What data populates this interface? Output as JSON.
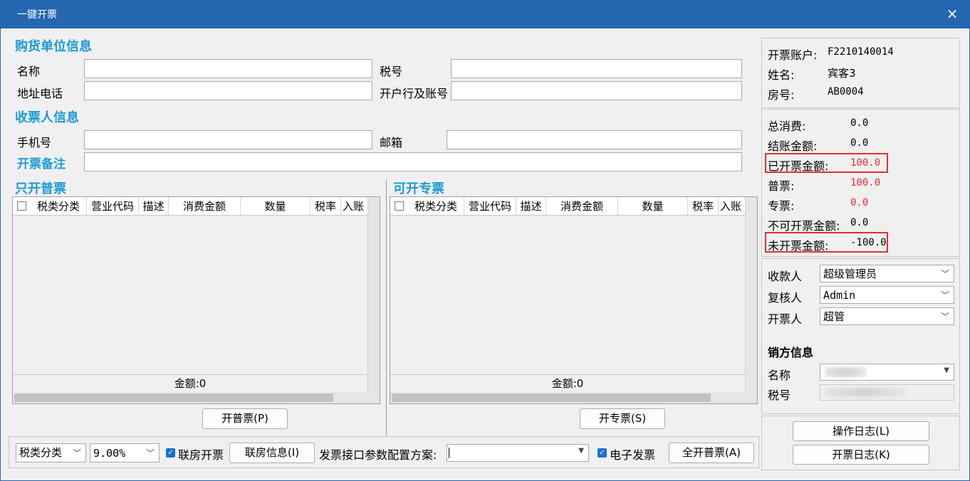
{
  "window": {
    "title": "一键开票",
    "close_glyph": "×"
  },
  "buyer": {
    "section_title": "购货单位信息",
    "name_label": "名称",
    "name_value": "",
    "tax_label": "税号",
    "tax_value": "",
    "address_label": "地址电话",
    "address_value": "",
    "bank_label": "开户行及账号",
    "bank_value": ""
  },
  "receiver": {
    "section_title": "收票人信息",
    "phone_label": "手机号",
    "phone_value": "",
    "email_label": "邮箱",
    "email_value": "",
    "remark_label": "开票备注",
    "remark_value": ""
  },
  "grid_columns": [
    "税类分类",
    "营业代码",
    "描述",
    "消费金额",
    "数量",
    "税率",
    "入账"
  ],
  "normal_invoice": {
    "title": "只开普票",
    "sum_text": "金额:0",
    "button": "开普票(P)"
  },
  "special_invoice": {
    "title": "可开专票",
    "sum_text": "金额:0",
    "button": "开专票(S)"
  },
  "bottom_bar": {
    "tax_category": "税类分类",
    "tax_rate": "9.00%",
    "link_room_label": "联房开票",
    "link_room_checked": true,
    "link_info_button": "联房信息(I)",
    "config_label": "发票接口参数配置方案:",
    "config_value": "",
    "e_invoice_label": "电子发票",
    "e_invoice_checked": true,
    "all_normal_button": "全开普票(A)"
  },
  "account": {
    "account_label": "开票账户:",
    "account_value": "F2210140014",
    "name_label": "姓名:",
    "name_value": "宾客3",
    "room_label": "房号:",
    "room_value": "AB0004"
  },
  "amounts": {
    "total_label": "总消费:",
    "total_value": "0.0",
    "settled_label": "结账金额:",
    "settled_value": "0.0",
    "invoiced_label": "已开票金额:",
    "invoiced_value": "100.0",
    "normal_label": "普票:",
    "normal_value": "100.0",
    "special_label": "专票:",
    "special_value": "0.0",
    "noninvoice_label": "不可开票金额:",
    "noninvoice_value": "0.0",
    "uninvoiced_label": "未开票金额:",
    "uninvoiced_value": "-100.0",
    "highlight_color": "#e03030"
  },
  "staff": {
    "payee_label": "收款人",
    "payee_value": "超级管理员",
    "reviewer_label": "复核人",
    "reviewer_value": "Admin",
    "drawer_label": "开票人",
    "drawer_value": "超管"
  },
  "seller": {
    "section_title": "销方信息",
    "name_label": "名称",
    "tax_label": "税号"
  },
  "actions": {
    "operation_log": "操作日志(L)",
    "invoice_log": "开票日志(K)"
  },
  "colors": {
    "titlebar": "#2467b0",
    "section_title": "#1f9ad6",
    "checkbox": "#1d6fcf"
  }
}
